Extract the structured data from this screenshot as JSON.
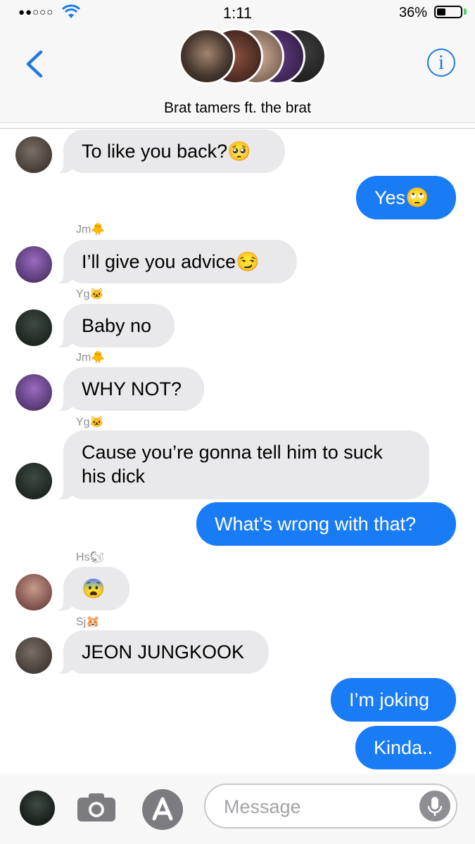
{
  "status_bar": {
    "time": "1:11",
    "signal": "●●○○○",
    "battery_percent": "36%",
    "battery_level": 0.36
  },
  "header": {
    "group_name": "Brat tamers ft. the brat",
    "info_glyph": "i"
  },
  "messages": [
    {
      "direction": "incoming",
      "text": "To like you back?🥺"
    },
    {
      "direction": "outgoing",
      "text": "Yes🙄"
    },
    {
      "direction": "incoming",
      "sender": "Jm🐥",
      "text": "I’ll give you advice😏"
    },
    {
      "direction": "incoming",
      "sender": "Yg🐱",
      "text": "Baby no"
    },
    {
      "direction": "incoming",
      "sender": "Jm🐥",
      "text": "WHY NOT?"
    },
    {
      "direction": "incoming",
      "sender": "Yg🐱",
      "text": "Cause you’re gonna tell him to suck his dick"
    },
    {
      "direction": "outgoing",
      "text": "What’s wrong with that?"
    },
    {
      "direction": "incoming",
      "sender": "Hs🐿",
      "text": "😨"
    },
    {
      "direction": "incoming",
      "sender": "Sj🐹",
      "text": "JEON JUNGKOOK"
    },
    {
      "direction": "outgoing",
      "text": "I’m joking"
    },
    {
      "direction": "outgoing",
      "text": "Kinda.."
    }
  ],
  "composer": {
    "placeholder": "Message",
    "icons": [
      "camera-icon",
      "app-store-icon",
      "microphone-icon"
    ]
  },
  "colors": {
    "outgoing_bubble": "#1a7cf5",
    "incoming_bubble": "#e9e9eb",
    "accent": "#1f7ae0"
  }
}
